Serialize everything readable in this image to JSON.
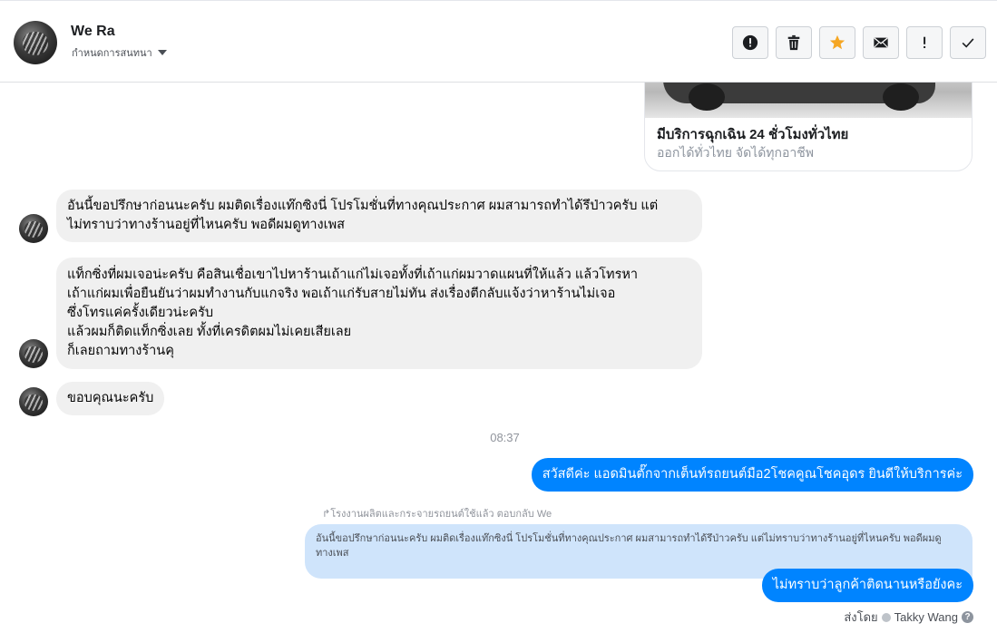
{
  "header": {
    "name": "We Ra",
    "subtitle": "กำหนดการสนทนา",
    "tools": [
      {
        "icon": "alert-circle-icon",
        "label": "Spam"
      },
      {
        "icon": "trash-icon",
        "label": "Delete"
      },
      {
        "icon": "star-icon",
        "label": "Star",
        "color": "#f5a623"
      },
      {
        "icon": "envelope-icon",
        "label": "Mark unread"
      },
      {
        "icon": "exclamation-icon",
        "label": "Follow up"
      },
      {
        "icon": "checkmark-icon",
        "label": "Done"
      }
    ]
  },
  "link_card": {
    "title": "มีบริการฉุกเฉิน 24 ชั่วโมงทั่วไทย",
    "subtitle": "ออกได้ทั่วไทย จัดได้ทุกอาชีพ"
  },
  "messages_in": [
    {
      "lines": [
        "อันนี้ขอปรึกษาก่อนนะครับ ผมติดเรื่องแท๊กซิงนี่ โปรโมชั่นที่ทางคุณประกาศ ผมสามารถทำได้รึป่าวครับ แต่",
        "ไม่ทราบว่าทางร้านอยู่ที่ไหนครับ พอดีผมดูทางเพส"
      ]
    },
    {
      "lines": [
        "แท็กซิ่งที่ผมเจอน่ะครับ คือสินเชื่อเขาไปหาร้านเถ้าแก่ไม่เจอทั้งที่เถ้าแก่ผมวาดแผนที่ให้แล้ว แล้วโทรหา",
        "เถ้าแก่ผมเพื่อยืนยันว่าผมทำงานกับแกจริง พอเถ้าแก่รับสายไม่ทัน ส่งเรื่องตีกลับแจ้งว่าหาร้านไม่เจอ",
        "ซึ่งโทรแค่ครั้งเดียวน่ะครับ",
        "แล้วผมก็ติดแท็กซิ่งเลย ทั้งที่เครดิตผมไม่เคยเสียเลย",
        "ก็เลยถามทางร้านคุ"
      ]
    },
    {
      "lines": [
        "ขอบคุณนะครับ"
      ]
    }
  ],
  "timestamp": "08:37",
  "messages_out": [
    {
      "text": "สวัสดีค่ะ แอดมินตั๊กจากเต็นท์รถยนต์มือ2โชคคูณโชคอุดร ยินดีให้บริการค่ะ"
    },
    {
      "text": "ไม่ทราบว่าลูกค้าติดนานหรือยังคะ"
    }
  ],
  "reply_note": "โรงงานผลิตและกระจายรถยนต์ใช้แล้ว ตอบกลับ We",
  "quoted": {
    "lines": [
      "อันนี้ขอปรึกษาก่อนนะครับ ผมติดเรื่องแท๊กซิงนี่ โปรโมชั่นที่ทางคุณประกาศ ผมสามารถทำได้รึป่าวครับ แต่ไม่ทราบว่าทางร้านอยู่ที่ไหนครับ พอดีผมดู",
      "ทางเพส"
    ]
  },
  "sent_by": {
    "prefix": "ส่งโดย",
    "name": "Takky Wang",
    "help": "?"
  }
}
